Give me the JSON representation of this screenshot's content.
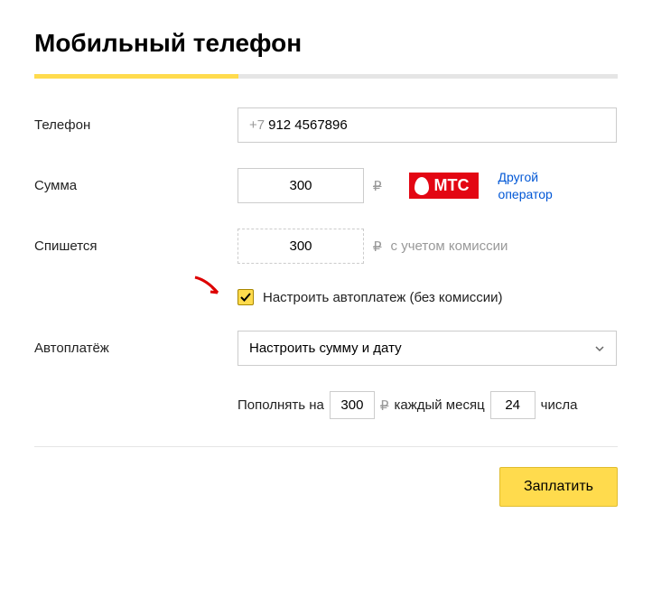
{
  "title": "Мобильный телефон",
  "fields": {
    "phone": {
      "label": "Телефон",
      "prefix": "+7",
      "value": "912 4567896"
    },
    "amount": {
      "label": "Сумма",
      "value": "300",
      "currency": "₽"
    },
    "charged": {
      "label": "Спишется",
      "value": "300",
      "currency": "₽",
      "hint": "с учетом комиссии"
    },
    "autopay": {
      "label": "Автоплатёж",
      "select_value": "Настроить сумму и дату"
    }
  },
  "operator": {
    "name": "МТС",
    "change_link": "Другой оператор"
  },
  "checkbox": {
    "label": "Настроить автоплатеж (без комиссии)",
    "checked": true
  },
  "autopay_detail": {
    "prefix": "Пополнять на",
    "amount": "300",
    "currency": "₽",
    "mid": "каждый месяц",
    "day": "24",
    "suffix": "числа"
  },
  "submit": {
    "label": "Заплатить"
  }
}
